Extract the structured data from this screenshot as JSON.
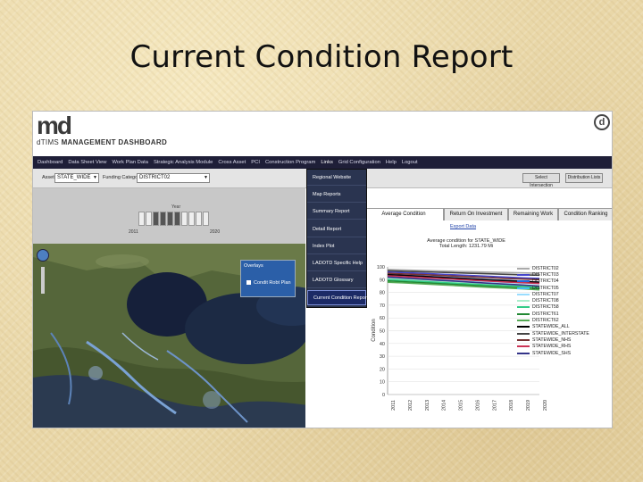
{
  "slide": {
    "title": "Current Condition Report"
  },
  "header": {
    "logo": "md",
    "subtitle_prefix": "dTIMS",
    "subtitle": "MANAGEMENT DASHBOARD",
    "corner_logo": "d"
  },
  "menubar": {
    "items": [
      "Dashboard",
      "Data Sheet View",
      "Work Plan Data",
      "Strategic Analysis Module",
      "Cross Asset",
      "PCI",
      "Construction Program",
      "Links",
      "Grid Configuration",
      "Help",
      "Logout"
    ]
  },
  "toolbar": {
    "asset_label": "Asset",
    "asset_value": "STATE_WIDE",
    "category_label": "Funding Category",
    "category_value": "DISTRICT02",
    "btn1": "Select Intersection",
    "btn2": "Distribution Lists"
  },
  "year_panel": {
    "label": "Year",
    "start": "2011",
    "end": "2020",
    "active_count": 4,
    "total_count": 10
  },
  "map": {
    "overlays_title": "Overlays",
    "overlay_item": "Condit Robt Plan"
  },
  "dropdown": {
    "items": [
      "Regional Website",
      "Map Reports",
      "Summary Report",
      "Detail Report",
      "Index Plot",
      "LADOTD Specific Help",
      "LADOTD Glossary",
      "Current Condition Report"
    ],
    "selected_index": 7
  },
  "tabs": [
    "Average Condition",
    "Return On Investment",
    "Remaining Work",
    "Condition Ranking"
  ],
  "chart_data": {
    "type": "line",
    "export_link": "Export Data",
    "title_lines": [
      "Average condition for STATE_WIDE",
      "Total Length: 1231.79 Mi"
    ],
    "ylabel": "Condition",
    "x": [
      "2011",
      "2012",
      "2013",
      "2014",
      "2015",
      "2016",
      "2017",
      "2018",
      "2019",
      "2020"
    ],
    "ylim": [
      0,
      100
    ],
    "yticks": [
      0,
      10,
      20,
      30,
      40,
      50,
      60,
      70,
      80,
      90,
      100
    ],
    "series": [
      {
        "name": "DISTRICT02",
        "color": "#aaaaaa",
        "values": [
          98,
          97.6,
          97.2,
          96.8,
          96.5,
          96.2,
          95.9,
          95.6,
          95.3,
          95
        ]
      },
      {
        "name": "DISTRICT03",
        "color": "#4444cc",
        "values": [
          96,
          95.5,
          95,
          94.4,
          93.8,
          93.2,
          92.6,
          92,
          91.4,
          91
        ]
      },
      {
        "name": "DISTRICT04",
        "color": "#2266dd",
        "values": [
          94,
          93.4,
          92.8,
          92.1,
          91.4,
          90.7,
          90,
          89.4,
          88.8,
          88
        ]
      },
      {
        "name": "DISTRICT05",
        "color": "#44bbee",
        "values": [
          93,
          92.5,
          91.8,
          91.1,
          90.4,
          89.8,
          89.1,
          88.6,
          88,
          87.5
        ]
      },
      {
        "name": "DISTRICT07",
        "color": "#99ddff",
        "values": [
          92,
          91.4,
          90.8,
          90.2,
          89.6,
          89,
          88.4,
          87.8,
          87.3,
          86.8
        ]
      },
      {
        "name": "DISTRICT08",
        "color": "#aaeecc",
        "values": [
          91,
          90.4,
          89.6,
          88.8,
          88,
          87.3,
          86.6,
          86,
          85.4,
          85
        ]
      },
      {
        "name": "DISTRICT58",
        "color": "#33cc88",
        "values": [
          90,
          89.4,
          88.6,
          87.9,
          87.2,
          86.5,
          85.8,
          85.2,
          84.7,
          84
        ]
      },
      {
        "name": "DISTRICT61",
        "color": "#228833",
        "values": [
          89,
          88.3,
          87.6,
          86.9,
          86.2,
          85.5,
          84.8,
          84.1,
          83.5,
          83
        ]
      },
      {
        "name": "DISTRICT62",
        "color": "#55aa55",
        "values": [
          88,
          87.4,
          86.8,
          86.1,
          85.4,
          84.7,
          84,
          83.4,
          82.8,
          82
        ]
      },
      {
        "name": "STATEWIDE_ALL",
        "color": "#000000",
        "values": [
          94,
          93.3,
          92.6,
          91.9,
          91.2,
          90.5,
          89.8,
          89.2,
          88.6,
          88
        ]
      },
      {
        "name": "STATEWIDE_INTERSTATE",
        "color": "#444444",
        "values": [
          97,
          96.6,
          96.2,
          95.8,
          95.4,
          95,
          94.6,
          94.2,
          93.8,
          93.5
        ]
      },
      {
        "name": "STATEWIDE_NHS",
        "color": "#773333",
        "values": [
          95,
          94.5,
          94,
          93.4,
          92.8,
          92.2,
          91.6,
          91,
          90.5,
          90
        ]
      },
      {
        "name": "STATEWIDE_RHS",
        "color": "#cc3355",
        "values": [
          93,
          92.4,
          91.7,
          91,
          90.3,
          89.6,
          88.9,
          88.2,
          87.6,
          87
        ]
      },
      {
        "name": "STATEWIDE_SHS",
        "color": "#333388",
        "values": [
          92,
          91.2,
          90.4,
          89.6,
          88.8,
          88,
          87.2,
          86.5,
          85.8,
          85
        ]
      }
    ]
  }
}
